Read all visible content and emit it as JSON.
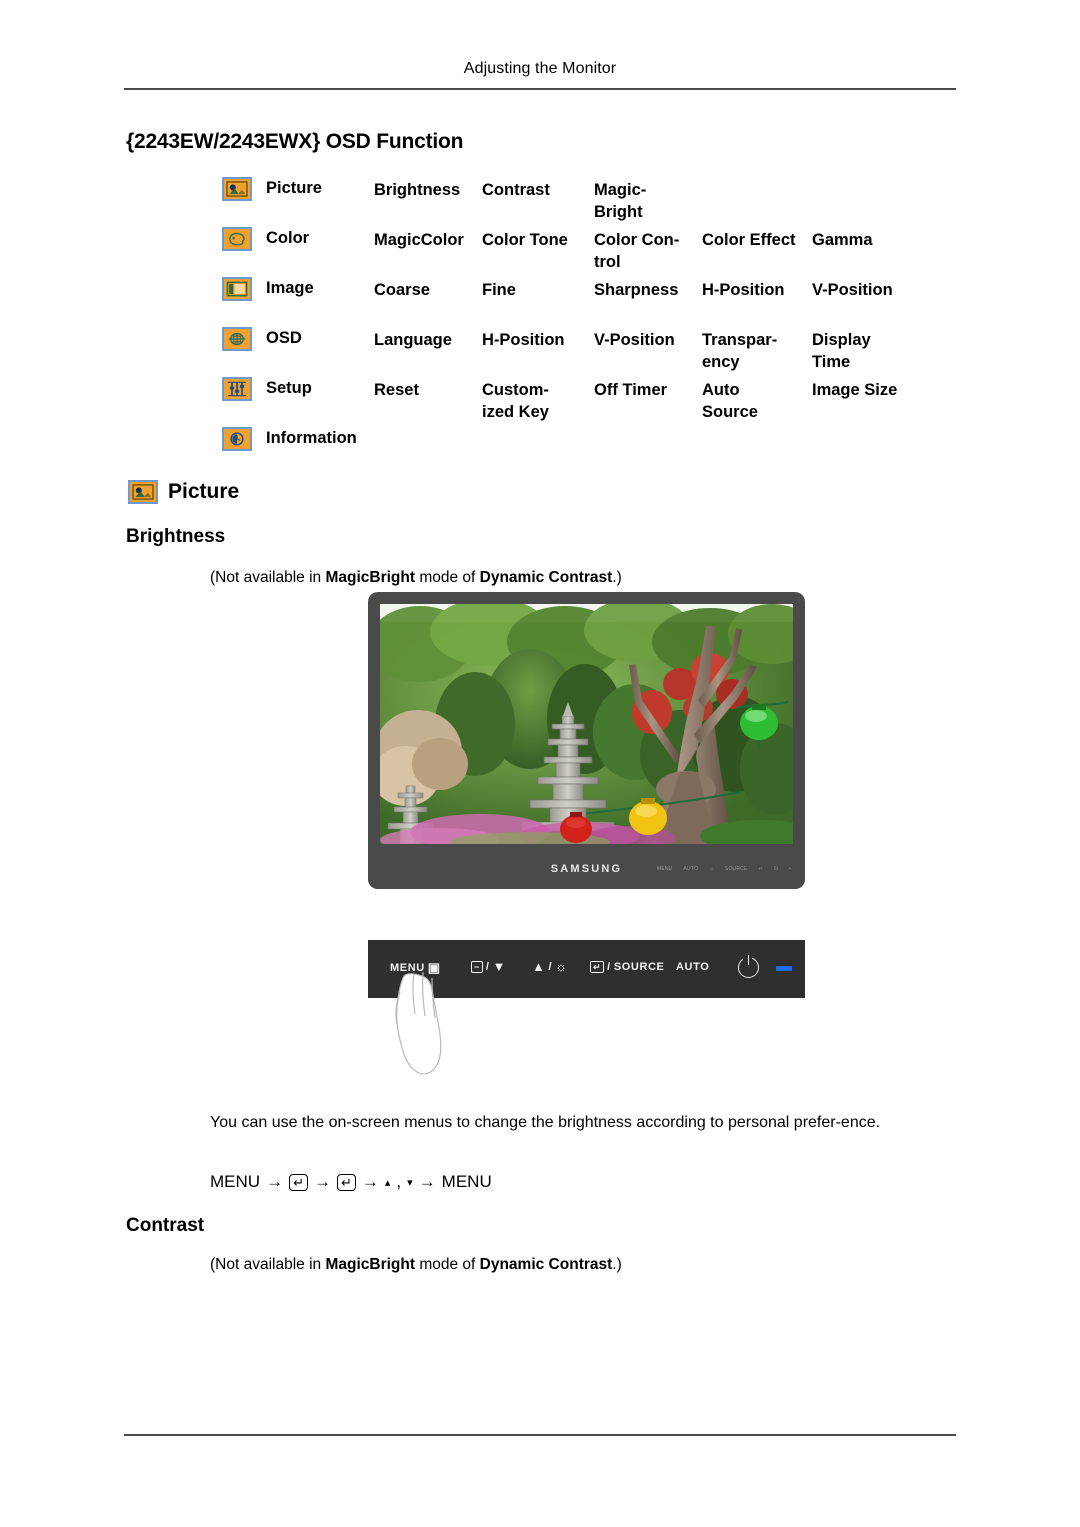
{
  "header": {
    "running_title": "Adjusting the Monitor"
  },
  "section": {
    "title": "{2243EW/2243EWX} OSD Function"
  },
  "osd_table": {
    "rows": [
      {
        "icon": "picture-icon",
        "name": "Picture",
        "items": [
          "Brightness",
          "Contrast",
          "Magic-\nBright",
          "",
          ""
        ]
      },
      {
        "icon": "color-palette-icon",
        "name": "Color",
        "items": [
          "MagicColor",
          "Color Tone",
          "Color  Con-\ntrol",
          "Color Effect",
          "Gamma"
        ]
      },
      {
        "icon": "image-icon",
        "name": "Image",
        "items": [
          "Coarse",
          "Fine",
          "Sharpness",
          "H-Position",
          "V-Position"
        ]
      },
      {
        "icon": "osd-icon",
        "name": "OSD",
        "items": [
          "Language",
          "H-Position",
          "V-Position",
          "Transpar-\nency",
          "Display\nTime"
        ]
      },
      {
        "icon": "setup-sliders-icon",
        "name": "Setup",
        "items": [
          "Reset",
          "Custom-\nized Key",
          "Off Timer",
          "Auto\nSource",
          "Image Size"
        ]
      },
      {
        "icon": "information-clock-icon",
        "name": "Information",
        "items": [
          "",
          "",
          "",
          "",
          ""
        ]
      }
    ]
  },
  "picture_section": {
    "heading": "Picture",
    "icon": "picture-icon",
    "brightness_heading": "Brightness",
    "brightness_note": {
      "prefix": "(Not available in ",
      "bold1": "MagicBright",
      "middle": "  mode of ",
      "bold2": "Dynamic Contrast",
      "suffix": ".)"
    },
    "paragraph": "You can use the on-screen menus to change the brightness according to personal prefer-ence.",
    "menu_path": {
      "start": "MENU",
      "arrow": "→",
      "enter": "↵",
      "up": "▴",
      "comma": ",",
      "down": "▾",
      "end": "MENU"
    }
  },
  "contrast_section": {
    "heading": "Contrast",
    "note": {
      "prefix": "(Not available in ",
      "bold1": "MagicBright",
      "middle": " mode of ",
      "bold2": "Dynamic Contrast",
      "suffix": ".)"
    }
  },
  "monitor": {
    "brand": "SAMSUNG",
    "bezel_keys": [
      "MENU",
      "AUTO",
      "☼",
      "SOURCE",
      "↵",
      "⏻",
      "•"
    ]
  },
  "control_panel": {
    "keys": [
      {
        "label": "MENU",
        "glyph": "▣",
        "name": "menu-button"
      },
      {
        "label": "",
        "glyph": "−",
        "sep": "/",
        "glyph2": "▼",
        "name": "down-button"
      },
      {
        "label": "",
        "glyph": "▲",
        "sep": "/",
        "glyph2": "☼",
        "name": "up-brightness-button"
      },
      {
        "label": "SOURCE",
        "glyph": "↵",
        "sep": "/",
        "name": "enter-source-button"
      },
      {
        "label": "AUTO",
        "glyph": "",
        "name": "auto-button"
      },
      {
        "label": "",
        "glyph": "power",
        "name": "power-button"
      },
      {
        "label": "",
        "glyph": "led",
        "name": "power-led"
      }
    ]
  },
  "colors": {
    "icon_fill": "#f0a22e",
    "icon_border": "#6f9ad1",
    "panel_bg": "#2f2f2f",
    "bezel": "#4a4a4a",
    "led": "#1a6ef0",
    "rule": "#4a4a4a"
  }
}
